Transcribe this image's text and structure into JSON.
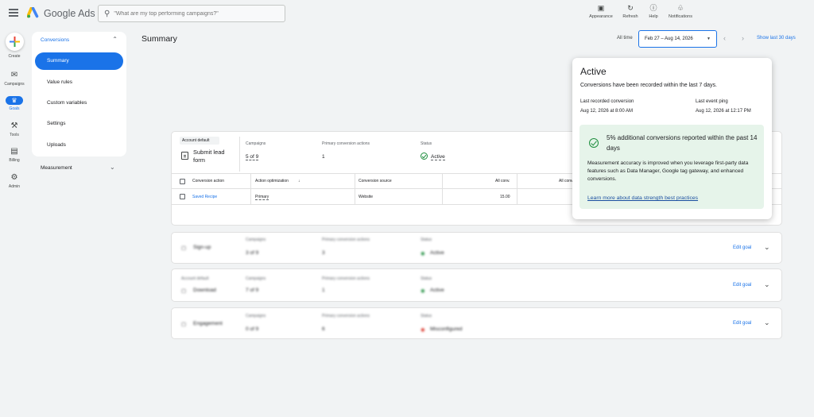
{
  "header": {
    "brand": "Google Ads",
    "search_placeholder": "\"What are my top performing campaigns?\"",
    "actions": [
      {
        "label": "Appearance",
        "icon": "appearance-icon"
      },
      {
        "label": "Refresh",
        "icon": "refresh-icon"
      },
      {
        "label": "Help",
        "icon": "help-icon"
      },
      {
        "label": "Notifications",
        "icon": "bell-icon"
      }
    ]
  },
  "rail": {
    "create": "Create",
    "campaigns": "Campaigns",
    "goals": "Goals",
    "tools": "Tools",
    "billing": "Billing",
    "admin": "Admin"
  },
  "nav": {
    "section": "Conversions",
    "items": [
      "Summary",
      "Value rules",
      "Custom variables",
      "Settings",
      "Uploads"
    ],
    "active": "Summary",
    "measurement": "Measurement"
  },
  "page": {
    "title": "Summary",
    "all_time": "All time",
    "date_range": "Feb 27 – Aug 14, 2026",
    "show_last": "Show last 30 days"
  },
  "goal_main": {
    "badge": "Account default",
    "name": "Submit lead form",
    "campaigns_label": "Campaigns",
    "campaigns_value": "5 of 9",
    "primary_label": "Primary conversion actions",
    "primary_value": "1",
    "status_label": "Status",
    "status_value": "Active",
    "table": {
      "headers": [
        "Conversion action",
        "Action optimization",
        "Conversion source",
        "All conv.",
        "All conv."
      ],
      "row": {
        "action": "Saved Recipe",
        "optimization": "Primary",
        "source": "Website",
        "value": "15.00"
      }
    }
  },
  "goals_collapsed": [
    {
      "name": "Sign-up",
      "campaigns": "3 of 9",
      "primary": "3",
      "status": "Active",
      "edit": "Edit goal"
    },
    {
      "name": "Download",
      "badge": "Account default",
      "campaigns": "7 of 9",
      "primary": "1",
      "status": "Active",
      "edit": "Edit goal"
    },
    {
      "name": "Engagement",
      "campaigns": "0 of 9",
      "primary": "6",
      "status": "Misconfigured",
      "edit": "Edit goal"
    }
  ],
  "collapsed_labels": {
    "campaigns": "Campaigns",
    "primary": "Primary conversion actions",
    "status": "Status"
  },
  "popover": {
    "title": "Active",
    "description": "Conversions have been recorded within the last 7 days.",
    "last_conversion_label": "Last recorded conversion",
    "last_conversion_value": "Aug 12, 2026 at 8:00 AM",
    "last_ping_label": "Last event ping",
    "last_ping_value": "Aug 12, 2026 at 12:17 PM",
    "highlight": "5% additional conversions reported within the past 14 days",
    "body": "Measurement accuracy is improved when you leverage first-party data features such as Data Manager, Google tag gateway, and enhanced conversions.",
    "link": "Learn more about data strength best practices"
  },
  "colors": {
    "accent": "#1a73e8",
    "success": "#1e8e3e",
    "success_bg": "#e6f4ea",
    "error": "#d93025"
  }
}
